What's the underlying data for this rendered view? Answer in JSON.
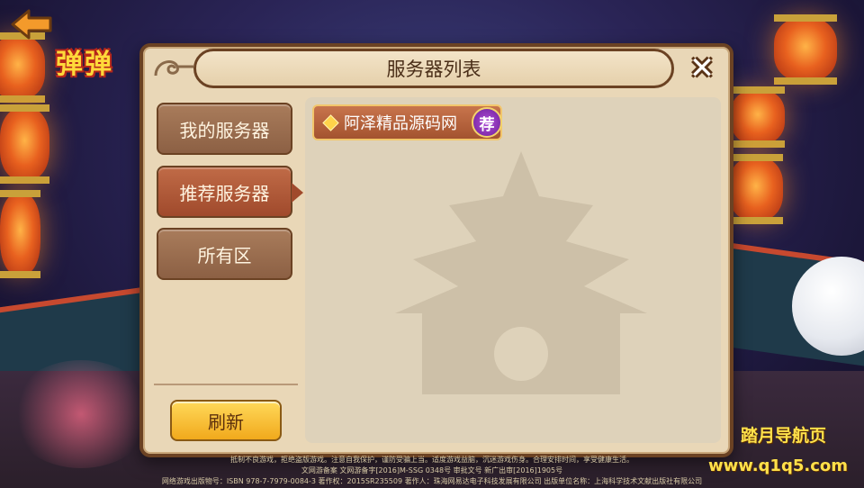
{
  "logo_text": "弹弹",
  "dialog": {
    "title": "服务器列表",
    "close_label": "✕"
  },
  "tabs": [
    {
      "label": "我的服务器",
      "selected": false
    },
    {
      "label": "推荐服务器",
      "selected": true
    },
    {
      "label": "所有区",
      "selected": false
    }
  ],
  "refresh_label": "刷新",
  "servers": [
    {
      "name": "阿泽精品源码网",
      "badge": "荐"
    }
  ],
  "footer": {
    "line1": "抵制不良游戏，拒绝盗版游戏。注意自我保护，谨防受骗上当。适度游戏益脑，沉迷游戏伤身。合理安排时间，享受健康生活。",
    "line2": "文网游备案  文网游备字[2016]M-SSG 0348号  审批文号  新广出审[2016]1905号",
    "line3": "网络游戏出版物号：ISBN 978-7-7979-0084-3  著作权：2015SR235509  著作人：珠海网易达电子科技发展有限公司  出版单位名称：上海科学技术文献出版社有限公司"
  },
  "watermark_site": {
    "name": "踏月导航页",
    "url": "www.q1q5.com"
  }
}
